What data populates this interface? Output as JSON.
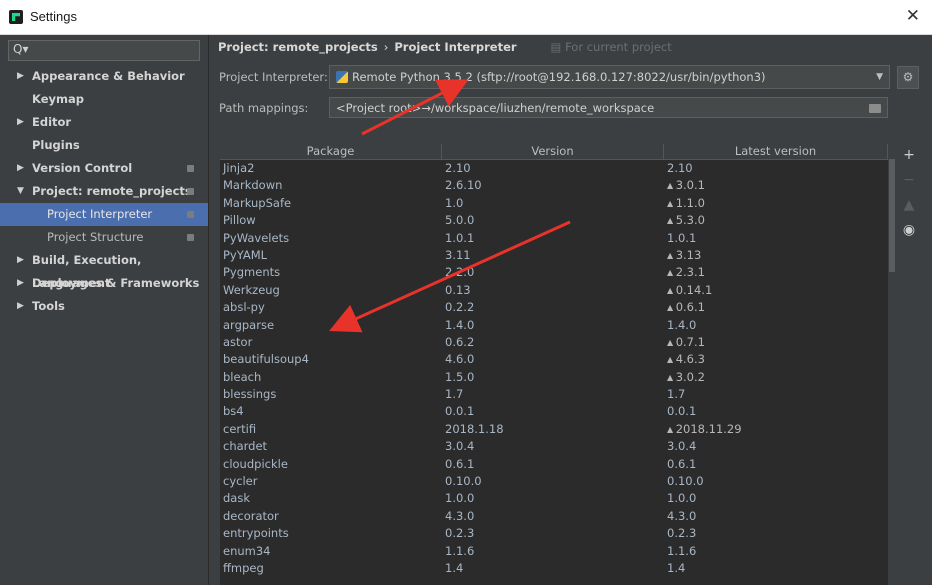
{
  "window": {
    "title": "Settings"
  },
  "sidebar": {
    "search_placeholder": "Q▾",
    "items": [
      {
        "label": "Appearance & Behavior",
        "arrow": "▶"
      },
      {
        "label": "Keymap"
      },
      {
        "label": "Editor",
        "arrow": "▶"
      },
      {
        "label": "Plugins"
      },
      {
        "label": "Version Control",
        "arrow": "▶"
      },
      {
        "label": "Project: remote_projects",
        "arrow": "▼"
      },
      {
        "label": "Project Interpreter"
      },
      {
        "label": "Project Structure"
      },
      {
        "label": "Build, Execution, Deployment",
        "arrow": "▶"
      },
      {
        "label": "Languages & Frameworks",
        "arrow": "▶"
      },
      {
        "label": "Tools",
        "arrow": "▶"
      }
    ]
  },
  "breadcrumb": {
    "project": "Project: remote_projects",
    "separator": "›",
    "page": "Project Interpreter",
    "scope": "For current project"
  },
  "interpreter": {
    "label": "Project Interpreter:",
    "value": "Remote Python 3.5.2 (sftp://root@192.168.0.127:8022/usr/bin/python3)"
  },
  "path_mappings": {
    "label": "Path mappings:",
    "value": "<Project root>→/workspace/liuzhen/remote_workspace"
  },
  "table": {
    "headers": [
      "Package",
      "Version",
      "Latest version"
    ],
    "rows": [
      {
        "package": "Jinja2",
        "version": "2.10",
        "latest": "2.10",
        "upgrade": false
      },
      {
        "package": "Markdown",
        "version": "2.6.10",
        "latest": "3.0.1",
        "upgrade": true
      },
      {
        "package": "MarkupSafe",
        "version": "1.0",
        "latest": "1.1.0",
        "upgrade": true
      },
      {
        "package": "Pillow",
        "version": "5.0.0",
        "latest": "5.3.0",
        "upgrade": true
      },
      {
        "package": "PyWavelets",
        "version": "1.0.1",
        "latest": "1.0.1",
        "upgrade": false
      },
      {
        "package": "PyYAML",
        "version": "3.11",
        "latest": "3.13",
        "upgrade": true
      },
      {
        "package": "Pygments",
        "version": "2.2.0",
        "latest": "2.3.1",
        "upgrade": true
      },
      {
        "package": "Werkzeug",
        "version": "0.13",
        "latest": "0.14.1",
        "upgrade": true
      },
      {
        "package": "absl-py",
        "version": "0.2.2",
        "latest": "0.6.1",
        "upgrade": true
      },
      {
        "package": "argparse",
        "version": "1.4.0",
        "latest": "1.4.0",
        "upgrade": false
      },
      {
        "package": "astor",
        "version": "0.6.2",
        "latest": "0.7.1",
        "upgrade": true
      },
      {
        "package": "beautifulsoup4",
        "version": "4.6.0",
        "latest": "4.6.3",
        "upgrade": true
      },
      {
        "package": "bleach",
        "version": "1.5.0",
        "latest": "3.0.2",
        "upgrade": true
      },
      {
        "package": "blessings",
        "version": "1.7",
        "latest": "1.7",
        "upgrade": false
      },
      {
        "package": "bs4",
        "version": "0.0.1",
        "latest": "0.0.1",
        "upgrade": false
      },
      {
        "package": "certifi",
        "version": "2018.1.18",
        "latest": "2018.11.29",
        "upgrade": true
      },
      {
        "package": "chardet",
        "version": "3.0.4",
        "latest": "3.0.4",
        "upgrade": false
      },
      {
        "package": "cloudpickle",
        "version": "0.6.1",
        "latest": "0.6.1",
        "upgrade": false
      },
      {
        "package": "cycler",
        "version": "0.10.0",
        "latest": "0.10.0",
        "upgrade": false
      },
      {
        "package": "dask",
        "version": "1.0.0",
        "latest": "1.0.0",
        "upgrade": false
      },
      {
        "package": "decorator",
        "version": "4.3.0",
        "latest": "4.3.0",
        "upgrade": false
      },
      {
        "package": "entrypoints",
        "version": "0.2.3",
        "latest": "0.2.3",
        "upgrade": false
      },
      {
        "package": "enum34",
        "version": "1.1.6",
        "latest": "1.1.6",
        "upgrade": false
      },
      {
        "package": "ffmpeg",
        "version": "1.4",
        "latest": "1.4",
        "upgrade": false
      }
    ]
  },
  "tools": {
    "add": "+",
    "remove": "−",
    "upgrade": "▲",
    "show_early": "◉"
  },
  "colors": {
    "annotation_arrow": "#e8332b",
    "selection": "#4b6eaf"
  }
}
